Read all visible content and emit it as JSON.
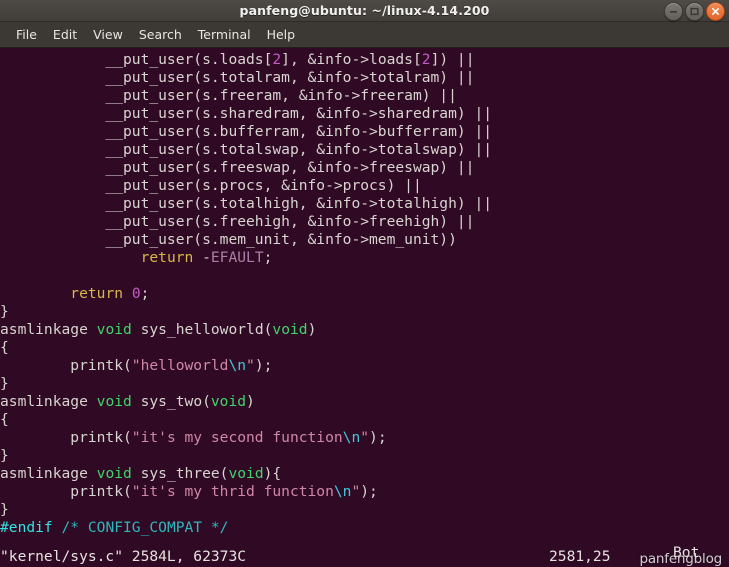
{
  "window": {
    "title": "panfeng@ubuntu: ~/linux-4.14.200",
    "controls": {
      "minimize": "minimize",
      "maximize": "maximize",
      "close": "close"
    }
  },
  "menubar": {
    "items": [
      {
        "label": "File"
      },
      {
        "label": "Edit"
      },
      {
        "label": "View"
      },
      {
        "label": "Search"
      },
      {
        "label": "Terminal"
      },
      {
        "label": "Help"
      }
    ]
  },
  "terminal": {
    "colors": {
      "background": "#300a24",
      "foreground": "#d3d7cf",
      "number": "#c35ac8",
      "statement": "#d7b74a",
      "constant": "#ad7fa8",
      "type": "#3fd46a",
      "string": "#cf87a6",
      "special": "#42c6da",
      "preproc": "#34e2e2",
      "comment": "#2fb7bd"
    },
    "lines": [
      {
        "id": "l01",
        "segments": [
          {
            "t": "            __put_user(s.loads[",
            "c": "plain"
          },
          {
            "t": "2",
            "c": "num"
          },
          {
            "t": "], &info->loads[",
            "c": "plain"
          },
          {
            "t": "2",
            "c": "num"
          },
          {
            "t": "]) ||",
            "c": "plain"
          }
        ]
      },
      {
        "id": "l02",
        "segments": [
          {
            "t": "            __put_user(s.totalram, &info->totalram) ||",
            "c": "plain"
          }
        ]
      },
      {
        "id": "l03",
        "segments": [
          {
            "t": "            __put_user(s.freeram, &info->freeram) ||",
            "c": "plain"
          }
        ]
      },
      {
        "id": "l04",
        "segments": [
          {
            "t": "            __put_user(s.sharedram, &info->sharedram) ||",
            "c": "plain"
          }
        ]
      },
      {
        "id": "l05",
        "segments": [
          {
            "t": "            __put_user(s.bufferram, &info->bufferram) ||",
            "c": "plain"
          }
        ]
      },
      {
        "id": "l06",
        "segments": [
          {
            "t": "            __put_user(s.totalswap, &info->totalswap) ||",
            "c": "plain"
          }
        ]
      },
      {
        "id": "l07",
        "segments": [
          {
            "t": "            __put_user(s.freeswap, &info->freeswap) ||",
            "c": "plain"
          }
        ]
      },
      {
        "id": "l08",
        "segments": [
          {
            "t": "            __put_user(s.procs, &info->procs) ||",
            "c": "plain"
          }
        ]
      },
      {
        "id": "l09",
        "segments": [
          {
            "t": "            __put_user(s.totalhigh, &info->totalhigh) ||",
            "c": "plain"
          }
        ]
      },
      {
        "id": "l10",
        "segments": [
          {
            "t": "            __put_user(s.freehigh, &info->freehigh) ||",
            "c": "plain"
          }
        ]
      },
      {
        "id": "l11",
        "segments": [
          {
            "t": "            __put_user(s.mem_unit, &info->mem_unit))",
            "c": "plain"
          }
        ]
      },
      {
        "id": "l12",
        "segments": [
          {
            "t": "                ",
            "c": "plain"
          },
          {
            "t": "return",
            "c": "stmt"
          },
          {
            "t": " -",
            "c": "plain"
          },
          {
            "t": "EFAULT",
            "c": "const"
          },
          {
            "t": ";",
            "c": "plain"
          }
        ]
      },
      {
        "id": "l13",
        "segments": [
          {
            "t": "",
            "c": "plain"
          }
        ]
      },
      {
        "id": "l14",
        "segments": [
          {
            "t": "        ",
            "c": "plain"
          },
          {
            "t": "return",
            "c": "stmt"
          },
          {
            "t": " ",
            "c": "plain"
          },
          {
            "t": "0",
            "c": "num"
          },
          {
            "t": ";",
            "c": "plain"
          }
        ]
      },
      {
        "id": "l15",
        "segments": [
          {
            "t": "}",
            "c": "plain"
          }
        ]
      },
      {
        "id": "l16",
        "segments": [
          {
            "t": "asmlinkage ",
            "c": "plain"
          },
          {
            "t": "void",
            "c": "type"
          },
          {
            "t": " sys_helloworld(",
            "c": "plain"
          },
          {
            "t": "void",
            "c": "type"
          },
          {
            "t": ")",
            "c": "plain"
          }
        ]
      },
      {
        "id": "l17",
        "segments": [
          {
            "t": "{",
            "c": "plain"
          }
        ]
      },
      {
        "id": "l18",
        "segments": [
          {
            "t": "        printk(",
            "c": "plain"
          },
          {
            "t": "\"helloworld",
            "c": "string"
          },
          {
            "t": "\\n",
            "c": "special"
          },
          {
            "t": "\"",
            "c": "string"
          },
          {
            "t": ");",
            "c": "plain"
          }
        ]
      },
      {
        "id": "l19",
        "segments": [
          {
            "t": "}",
            "c": "plain"
          }
        ]
      },
      {
        "id": "l20",
        "segments": [
          {
            "t": "asmlinkage ",
            "c": "plain"
          },
          {
            "t": "void",
            "c": "type"
          },
          {
            "t": " sys_two(",
            "c": "plain"
          },
          {
            "t": "void",
            "c": "type"
          },
          {
            "t": ")",
            "c": "plain"
          }
        ]
      },
      {
        "id": "l21",
        "segments": [
          {
            "t": "{",
            "c": "plain"
          }
        ]
      },
      {
        "id": "l22",
        "segments": [
          {
            "t": "        printk(",
            "c": "plain"
          },
          {
            "t": "\"it's my second function",
            "c": "string"
          },
          {
            "t": "\\n",
            "c": "special"
          },
          {
            "t": "\"",
            "c": "string"
          },
          {
            "t": ");",
            "c": "plain"
          }
        ]
      },
      {
        "id": "l23",
        "segments": [
          {
            "t": "}",
            "c": "plain"
          }
        ]
      },
      {
        "id": "l24",
        "segments": [
          {
            "t": "asmlinkage ",
            "c": "plain"
          },
          {
            "t": "void",
            "c": "type"
          },
          {
            "t": " sys_three(",
            "c": "plain"
          },
          {
            "t": "void",
            "c": "type"
          },
          {
            "t": "){",
            "c": "plain"
          }
        ]
      },
      {
        "id": "l25",
        "segments": [
          {
            "t": "        printk(",
            "c": "plain"
          },
          {
            "t": "\"it's my thrid function",
            "c": "string"
          },
          {
            "t": "\\n",
            "c": "special"
          },
          {
            "t": "\"",
            "c": "string"
          },
          {
            "t": ");",
            "c": "plain"
          }
        ]
      },
      {
        "id": "l26",
        "segments": [
          {
            "t": "}",
            "c": "plain"
          }
        ]
      },
      {
        "id": "l27",
        "segments": [
          {
            "t": "#endif",
            "c": "prepro"
          },
          {
            "t": " ",
            "c": "plain"
          },
          {
            "t": "/* CONFIG_COMPAT */",
            "c": "comment"
          }
        ]
      }
    ],
    "statusline": {
      "file": "\"kernel/sys.c\" 2584L, 62373C",
      "ruler": "2581,25",
      "position": "Bot"
    },
    "watermark": "panfengblog"
  }
}
